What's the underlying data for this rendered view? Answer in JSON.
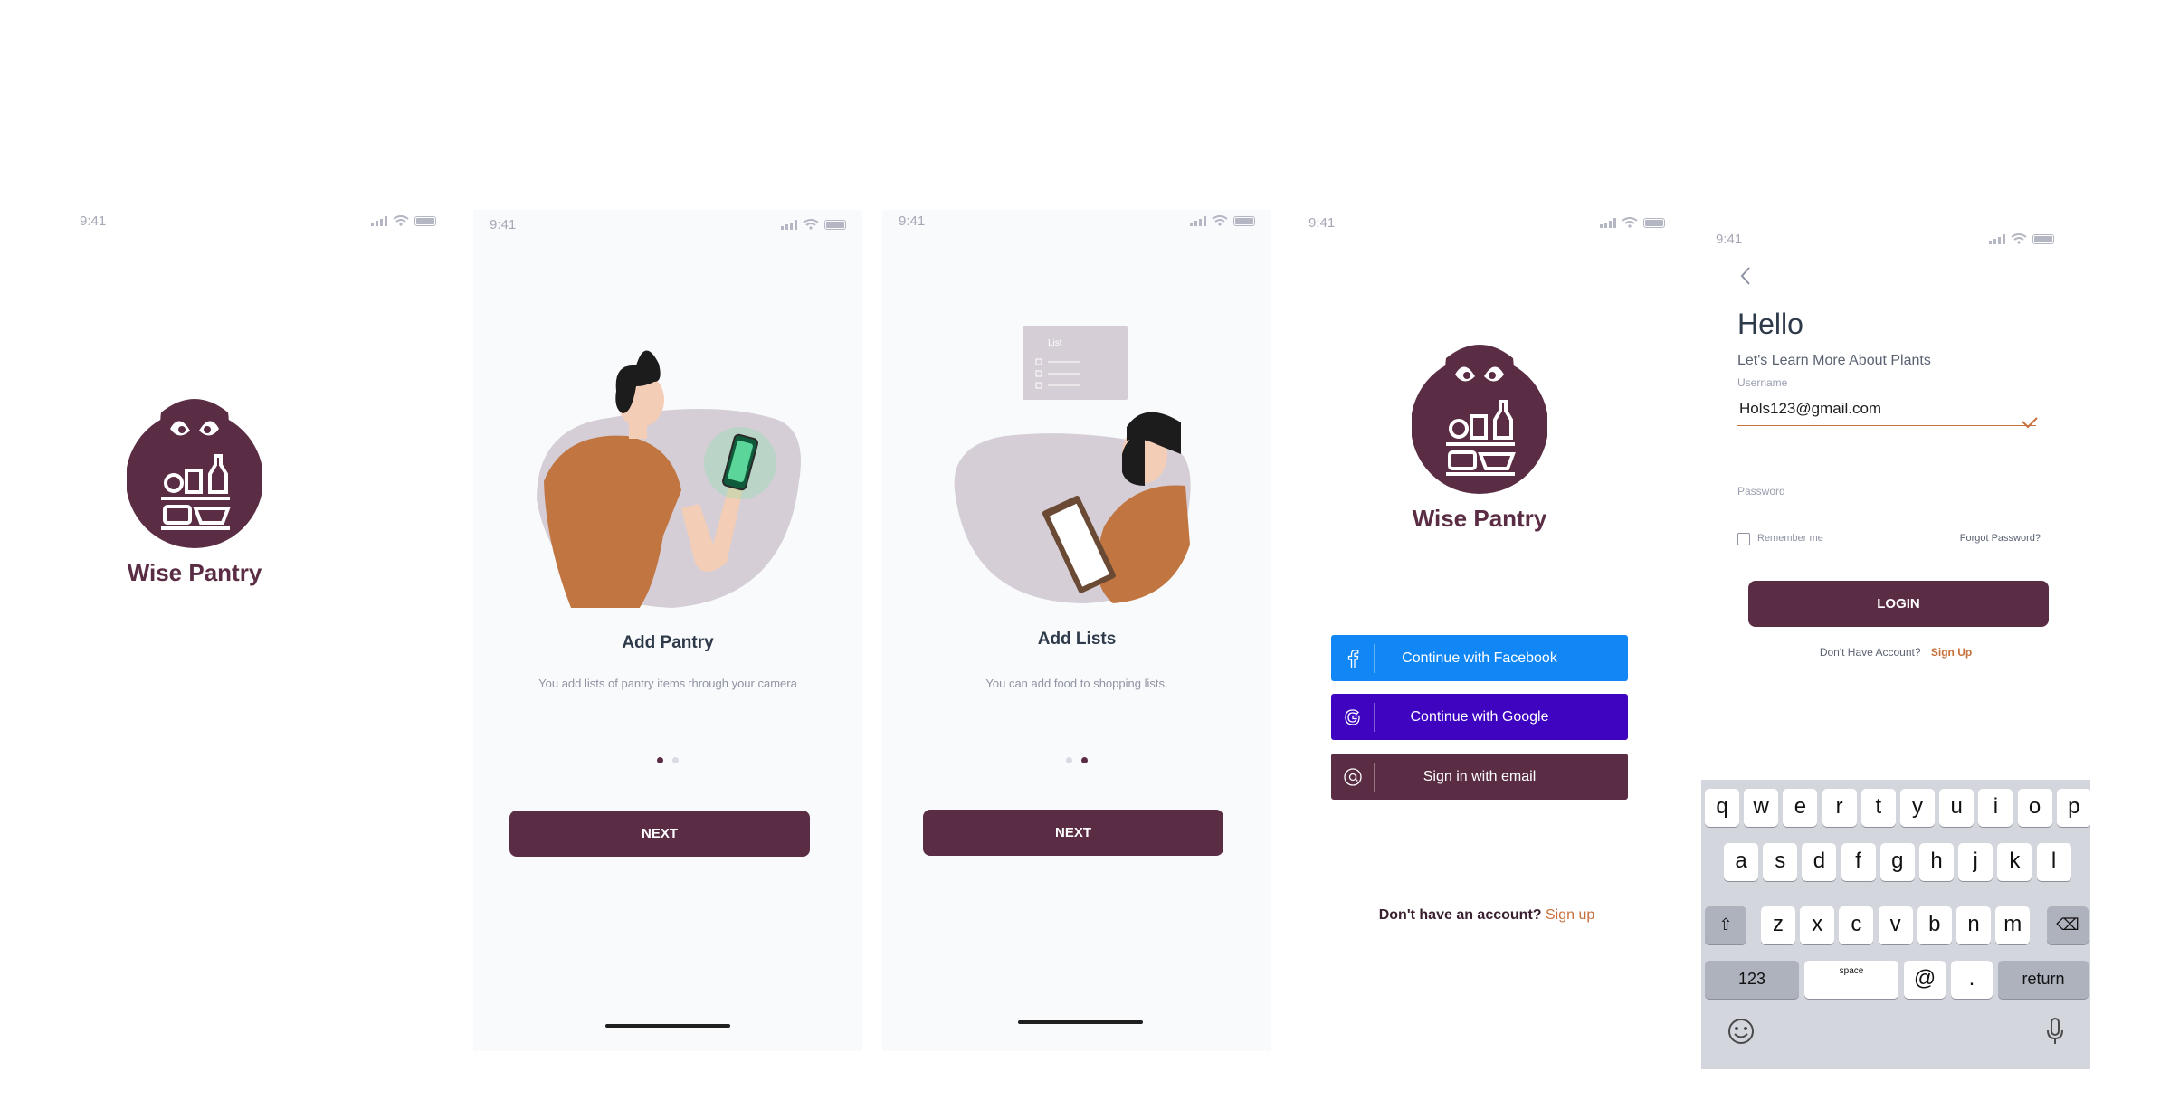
{
  "status_time": "9:41",
  "splash": {
    "brand": "Wise Pantry"
  },
  "onboarding": [
    {
      "title": "Add Pantry",
      "description": "You add lists of pantry items through your camera",
      "button": "NEXT",
      "active_page": 1,
      "pages": 2
    },
    {
      "title": "Add Lists",
      "description": "You can add food to shopping lists.",
      "button": "NEXT",
      "active_page": 2,
      "pages": 2,
      "card_label": "List"
    }
  ],
  "signin": {
    "brand": "Wise Pantry",
    "facebook": "Continue with Facebook",
    "google": "Continue with Google",
    "email": "Sign in with email",
    "no_account": "Don't have an account?",
    "signup": "Sign up",
    "colors": {
      "facebook": "#1187f5",
      "google": "#3e04c0",
      "email": "#5a2d44"
    }
  },
  "login": {
    "greeting": "Hello",
    "subtitle": "Let's Learn More About Plants",
    "username_label": "Username",
    "username_value": "Hols123@gmail.com",
    "password_label": "Password",
    "remember": "Remember me",
    "forgot": "Forgot Password?",
    "login_button": "LOGIN",
    "no_account": "Don't Have Account?",
    "signup": "Sign Up"
  },
  "keyboard": {
    "row1": [
      "q",
      "w",
      "e",
      "r",
      "t",
      "y",
      "u",
      "i",
      "o",
      "p"
    ],
    "row2": [
      "a",
      "s",
      "d",
      "f",
      "g",
      "h",
      "j",
      "k",
      "l"
    ],
    "row3": [
      "z",
      "x",
      "c",
      "v",
      "b",
      "n",
      "m"
    ],
    "numbers": "123",
    "space": "space",
    "at": "@",
    "dot": ".",
    "return": "return"
  },
  "colors": {
    "brand": "#5a2d44",
    "accent": "#c8703a",
    "blob": "#d5ced6"
  }
}
